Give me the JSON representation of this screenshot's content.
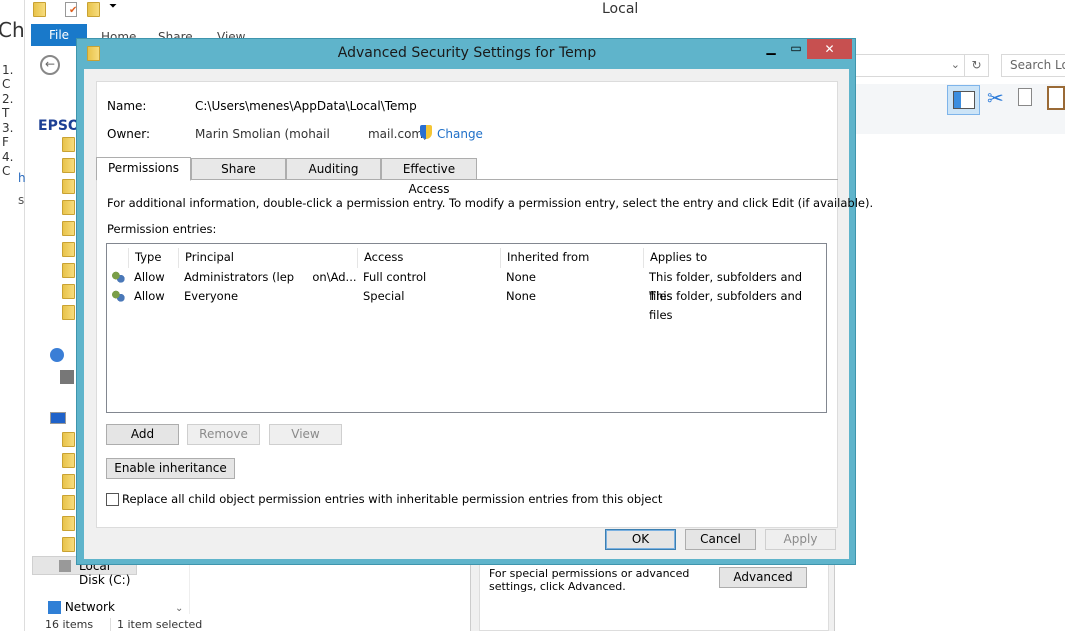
{
  "background_page": {
    "heading_fragment": "Cha",
    "list_fragments": [
      "1. C",
      "2. T",
      "3. F",
      "4. C",
      "h",
      "s"
    ]
  },
  "explorer": {
    "title": "Local",
    "ribbon_tabs": [
      "File",
      "Home",
      "Share",
      "View"
    ],
    "search_placeholder": "Search Loc",
    "nav_logo_fragment": "EPSO",
    "nav_items": {
      "local_disk": "Local Disk (C:)",
      "network": "Network"
    },
    "status": {
      "items": "16 items",
      "selected": "1 item selected"
    },
    "properties_pane": {
      "hint": "For special permissions or advanced settings, click Advanced.",
      "advanced_button": "Advanced"
    }
  },
  "dialog": {
    "title": "Advanced Security Settings for Temp",
    "name_label": "Name:",
    "name_value": "C:\\Users\\menes\\AppData\\Local\\Temp",
    "owner_label": "Owner:",
    "owner_value": "Marin Smolian (mohail          mail.com)",
    "change_link": "Change",
    "tabs": [
      "Permissions",
      "Share",
      "Auditing",
      "Effective Access"
    ],
    "active_tab": "Permissions",
    "info_text": "For additional information, double-click a permission entry. To modify a permission entry, select the entry and click Edit (if available).",
    "entries_label": "Permission entries:",
    "columns": [
      "Type",
      "Principal",
      "Access",
      "Inherited from",
      "Applies to"
    ],
    "rows": [
      {
        "type": "Allow",
        "principal": "Administrators (lep     on\\Ad...",
        "access": "Full control",
        "inherited": "None",
        "applies": "This folder, subfolders and files"
      },
      {
        "type": "Allow",
        "principal": "Everyone",
        "access": "Special",
        "inherited": "None",
        "applies": "This folder, subfolders and files"
      }
    ],
    "buttons": {
      "add": "Add",
      "remove": "Remove",
      "view": "View",
      "enable_inheritance": "Enable inheritance",
      "ok": "OK",
      "cancel": "Cancel",
      "apply": "Apply"
    },
    "replace_checkbox": {
      "label": "Replace all child object permission entries with inheritable permission entries from this object",
      "checked": false
    },
    "colors": {
      "frame": "#5fb4cb",
      "close": "#c75050",
      "link": "#1e6fc8"
    }
  }
}
